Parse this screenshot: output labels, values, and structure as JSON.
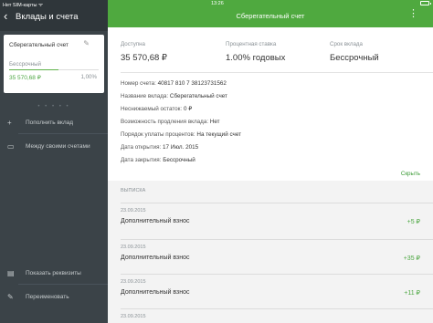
{
  "status_bar": {
    "carrier": "Нет SIM-карты ᯤ",
    "time": "13:26"
  },
  "left_panel": {
    "back_glyph": "‹",
    "title": "Вклады и счета",
    "account_card": {
      "name": "Сберегательный счет",
      "term": "Бессрочный",
      "amount": "35 570,68 ₽",
      "rate": "1,00%",
      "progress": 0.55
    },
    "pager_dots": "• • • • •",
    "menu": {
      "add": "Пополнить вклад",
      "transfer": "Между своими счетами",
      "details": "Показать реквизиты",
      "rename": "Переименовать"
    }
  },
  "header": {
    "title": "Сберегательный счет",
    "menu_glyph": "⋮"
  },
  "summary": {
    "available_label": "Доступна",
    "available_value": "35 570,68 ₽",
    "rate_label": "Процентная ставка",
    "rate_value": "1.00% годовых",
    "term_label": "Срок вклада",
    "term_value": "Бессрочный"
  },
  "details": {
    "account_number_label": "Номер счета:",
    "account_number": "40817 810 7 38123731562",
    "deposit_name_label": "Название вклада:",
    "deposit_name": "Сберегательный счет",
    "min_balance_label": "Неснижаемый остаток:",
    "min_balance": "0 ₽",
    "extension_label": "Возможность продления вклада:",
    "extension": "Нет",
    "interest_label": "Порядок уплаты процентов:",
    "interest": "На текущий счет",
    "open_date_label": "Дата открытия:",
    "open_date": "17 Июл. 2015",
    "close_date_label": "Дата закрытия:",
    "close_date": "Бессрочный",
    "collapse_link": "Скрыть"
  },
  "statement": {
    "section_label": "ВЫПИСКА",
    "operations": [
      {
        "date": "23.09.2015",
        "name": "Дополнительный взнос",
        "amount": "+5 ₽"
      },
      {
        "date": "23.09.2015",
        "name": "Дополнительный взнос",
        "amount": "+35 ₽"
      },
      {
        "date": "23.09.2015",
        "name": "Дополнительный взнос",
        "amount": "+11 ₽"
      },
      {
        "date": "23.09.2015",
        "name": "",
        "amount": ""
      }
    ]
  },
  "colors": {
    "accent": "#4fa93f",
    "sidebar": "#3b4348",
    "sidebar_header": "#2f363a"
  }
}
